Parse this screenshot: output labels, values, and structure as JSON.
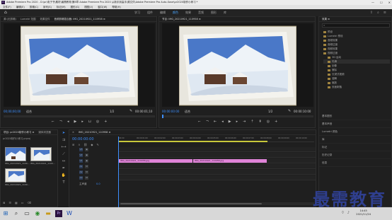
{
  "window": {
    "logo": "Pr",
    "title": "Adobe Premiere Pro 2020 - D:\\pr\\电子书\\素材\\最需教育\\第8章 Adobe Premiere Pro 2020 从新手到高手\\源文件\\Adobe Premiere Pro Auto-Save\\pr2020制作小练习 *",
    "controls": [
      "—",
      "☐",
      "✕"
    ]
  },
  "menu": [
    "文件(F)",
    "编辑(E)",
    "剪辑(C)",
    "序列(S)",
    "标记(M)",
    "图形(G)",
    "视图(V)",
    "窗口(W)",
    "帮助(H)"
  ],
  "workspaces": {
    "tabs": [
      "学习",
      "组件",
      "编辑",
      "颜色",
      "效果",
      "音频",
      "图形",
      "库"
    ],
    "active_index": 3,
    "icons": [
      "search-icon",
      "share-icon",
      "settings-icon"
    ]
  },
  "source_monitor": {
    "tabs": [
      "源:(无剪辑)",
      "Lumetri 范围",
      "效果控件",
      "音频剪辑混合器: IMG_20210921_110958 ≡"
    ],
    "timecode_left": "00;00;00;00",
    "fit_label": "适合",
    "fraction": "1/2",
    "timecode_right": "00:00:01;10"
  },
  "program_monitor": {
    "tabs": [
      "节目: IMG_20210921_110958 ≡"
    ],
    "timecode_left": "00:00:00:00",
    "fit_label": "适合",
    "fraction": "1/2",
    "timecode_right": "00:00:10:00"
  },
  "project": {
    "tabs": [
      "项目: pr2020制作小练习 ≡",
      "媒体浏览器"
    ],
    "file_label": "pr2020制作小练习.prproj",
    "items": [
      {
        "name": "IMG_20210921_1109...",
        "duration": "5:00"
      },
      {
        "name": "IMG_20210921_1109...",
        "duration": "5:00"
      },
      {
        "name": "IMG_20210921_1109...",
        "duration": "5:00"
      }
    ]
  },
  "timeline": {
    "tab": "IMG_20210921_110958 ≡",
    "timecode": "00:00:00:00",
    "ruler": [
      "00:00",
      "00:00:01:00",
      "00:00:02:00",
      "00:00:03:00",
      "00:00:04:00",
      "00:00:05:00",
      "00:00:06:00",
      "00:00:07:00",
      "00:00:08:00",
      "00:00:09:00",
      "00:00:10:00"
    ],
    "tracks": [
      {
        "label": "V3",
        "clips": []
      },
      {
        "label": "V2",
        "clips": []
      },
      {
        "label": "V1",
        "clips": [
          "IMG_20210921_110958.jpg",
          "IMG_20210921_110958.jpg"
        ]
      },
      {
        "label": "A1",
        "clips": []
      },
      {
        "label": "A2",
        "clips": []
      },
      {
        "label": "A3",
        "clips": []
      }
    ],
    "master_label": "主声道",
    "master_value": "0.0"
  },
  "effects": {
    "tab": "效果 ≡",
    "tree": [
      "预设",
      "Lumetri 预设",
      "音频效果",
      "音频过渡",
      "视频效果",
      "视频过渡",
      "3D 运动",
      "内滑",
      "划像",
      "擦除",
      "沉浸式视频",
      "溶解",
      "缩放",
      "页面剥落"
    ],
    "lower_panels": [
      "基本图形",
      "基本声音",
      "Lumetri 颜色",
      "库",
      "标记",
      "历史记录",
      "信息"
    ]
  },
  "taskbar": {
    "time": "14:45",
    "date": "2021/11/24"
  },
  "watermark": "最需教育",
  "colors": {
    "accent_blue": "#3d8fff",
    "clip_pink": "#e084d8",
    "panel_bg": "#1f1f1f"
  }
}
